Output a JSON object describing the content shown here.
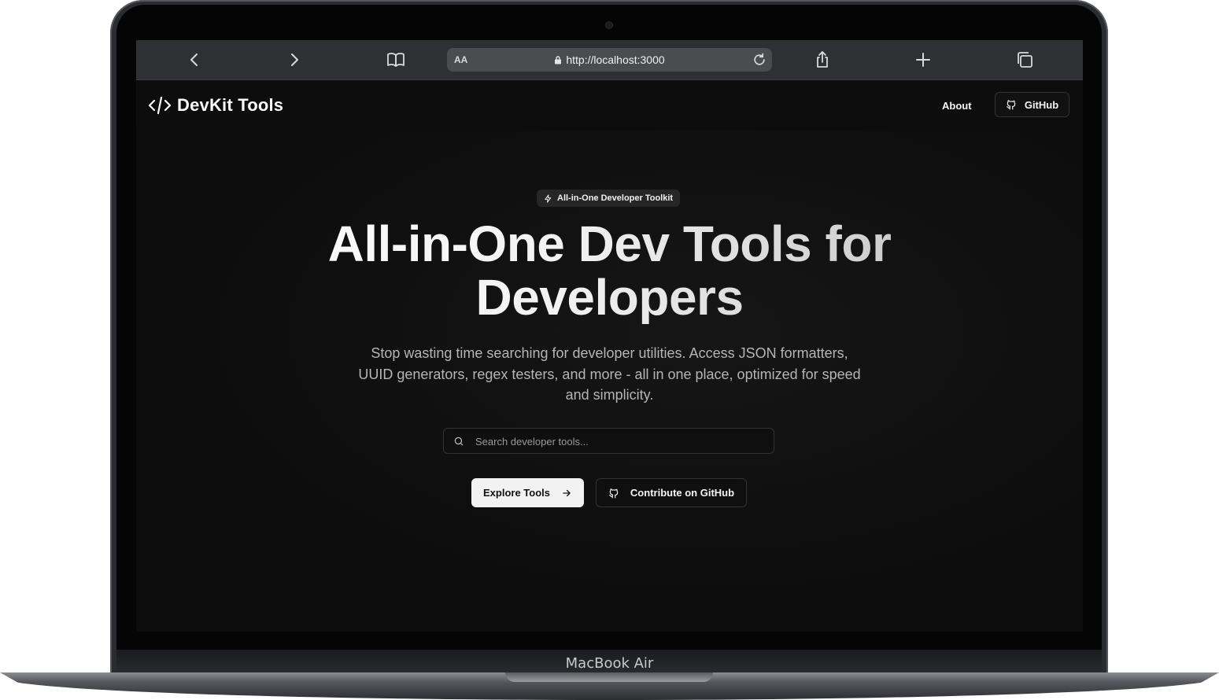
{
  "device": {
    "label": "MacBook Air"
  },
  "browser": {
    "url": "http://localhost:3000",
    "text_size_label": "AA"
  },
  "site": {
    "brand": "DevKit Tools",
    "nav": {
      "about": "About",
      "github": "GitHub"
    }
  },
  "hero": {
    "badge": "All-in-One Developer Toolkit",
    "headline_line1": "All-in-One Dev Tools for",
    "headline_line2": "Developers",
    "subtext": "Stop wasting time searching for developer utilities. Access JSON formatters, UUID generators, regex testers, and more - all in one place, optimized for speed and simplicity.",
    "search_placeholder": "Search developer tools...",
    "primary_button": "Explore Tools",
    "secondary_button": "Contribute on GitHub"
  },
  "colors": {
    "background": "#0d0d0d",
    "toolbar": "#2e3033",
    "primary_button_bg": "#f2f2f2"
  }
}
